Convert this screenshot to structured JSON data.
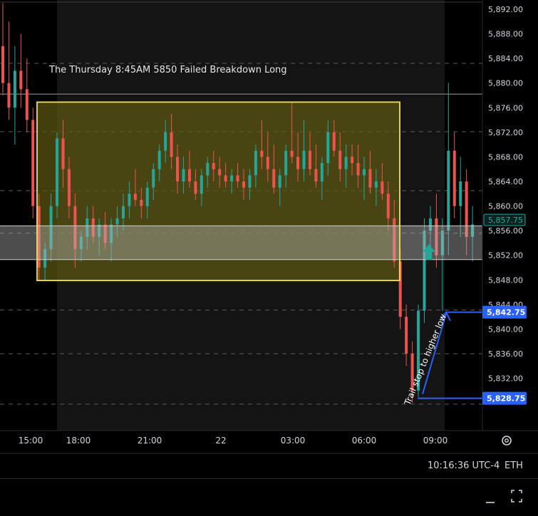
{
  "chart_data": {
    "type": "candlestick",
    "annotation_title": "The Thursday 8:45AM 5850 Failed Breakdown Long",
    "trail_label": "Trail stop to higher low",
    "ylim": [
      5823.5,
      5893.5
    ],
    "y_ticks": [
      5892,
      5888,
      5884,
      5880,
      5876,
      5872,
      5868,
      5864,
      5860,
      5856,
      5852,
      5848,
      5844,
      5840,
      5836,
      5832
    ],
    "y_tick_labels": [
      "5,892.00",
      "5,888.00",
      "5,884.00",
      "5,880.00",
      "5,876.00",
      "5,872.00",
      "5,868.00",
      "5,864.00",
      "5,860.00",
      "5,856.00",
      "5,852.00",
      "5,848.00",
      "5,844.00",
      "5,840.00",
      "5,836.00",
      "5,832.00"
    ],
    "x_tick_labels": [
      "15:00",
      "18:00",
      "21:00",
      "22",
      "03:00",
      "06:00",
      "09:00"
    ],
    "dashed_levels": [
      5883.2,
      5872.1,
      5862.5,
      5855.6,
      5843.1,
      5836.0,
      5827.8
    ],
    "resistance_level": 5878.2,
    "range_box": {
      "top": 5876.9,
      "bottom": 5847.9
    },
    "value_zone": {
      "top": 5856.8,
      "bottom": 5851.3
    },
    "price_labels": [
      {
        "text": "5,857.75",
        "value": 5857.75,
        "style": "current"
      },
      {
        "text": "5,842.75",
        "value": 5842.75,
        "style": "marker"
      },
      {
        "text": "5,828.75",
        "value": 5828.75,
        "style": "marker"
      }
    ],
    "trade_markers": [
      {
        "type": "long-arrow",
        "value": 5852.2,
        "color": "#26a69a"
      }
    ],
    "candles": [
      [
        5886,
        5893,
        5878,
        5880
      ],
      [
        5880,
        5890,
        5874,
        5876
      ],
      [
        5876,
        5886,
        5870,
        5882
      ],
      [
        5882,
        5888,
        5876,
        5879
      ],
      [
        5879,
        5884,
        5872,
        5874
      ],
      [
        5874,
        5876,
        5858,
        5860
      ],
      [
        5860,
        5862,
        5848,
        5850
      ],
      [
        5850,
        5854,
        5848,
        5853
      ],
      [
        5853,
        5862,
        5851,
        5860
      ],
      [
        5860,
        5872,
        5858,
        5871
      ],
      [
        5871,
        5874,
        5863,
        5866
      ],
      [
        5866,
        5868,
        5858,
        5860
      ],
      [
        5860,
        5862,
        5850,
        5853
      ],
      [
        5853,
        5856,
        5851,
        5855
      ],
      [
        5855,
        5860,
        5853,
        5858
      ],
      [
        5858,
        5860,
        5854,
        5855
      ],
      [
        5855,
        5858,
        5852,
        5857
      ],
      [
        5857,
        5859,
        5853,
        5854
      ],
      [
        5854,
        5858,
        5851,
        5857
      ],
      [
        5857,
        5860,
        5855,
        5858
      ],
      [
        5858,
        5862,
        5856,
        5860
      ],
      [
        5860,
        5864,
        5858,
        5862
      ],
      [
        5862,
        5866,
        5860,
        5861
      ],
      [
        5861,
        5863,
        5858,
        5860
      ],
      [
        5860,
        5864,
        5858,
        5863
      ],
      [
        5863,
        5867,
        5861,
        5866
      ],
      [
        5866,
        5870,
        5864,
        5869
      ],
      [
        5869,
        5874,
        5867,
        5872
      ],
      [
        5872,
        5875,
        5866,
        5868
      ],
      [
        5868,
        5870,
        5862,
        5864
      ],
      [
        5864,
        5868,
        5862,
        5866
      ],
      [
        5866,
        5869,
        5863,
        5864
      ],
      [
        5864,
        5866,
        5861,
        5862
      ],
      [
        5862,
        5866,
        5860,
        5865
      ],
      [
        5865,
        5868,
        5863,
        5867
      ],
      [
        5867,
        5869,
        5864,
        5866
      ],
      [
        5866,
        5868,
        5863,
        5865
      ],
      [
        5865,
        5867,
        5863,
        5864
      ],
      [
        5864,
        5866,
        5862,
        5865
      ],
      [
        5865,
        5867,
        5863,
        5864
      ],
      [
        5864,
        5866,
        5861,
        5863
      ],
      [
        5863,
        5866,
        5861,
        5865
      ],
      [
        5865,
        5870,
        5863,
        5869
      ],
      [
        5869,
        5874,
        5866,
        5868
      ],
      [
        5868,
        5872,
        5864,
        5866
      ],
      [
        5866,
        5870,
        5862,
        5863
      ],
      [
        5863,
        5866,
        5860,
        5865
      ],
      [
        5865,
        5870,
        5863,
        5869
      ],
      [
        5869,
        5877,
        5867,
        5868
      ],
      [
        5868,
        5872,
        5864,
        5866
      ],
      [
        5866,
        5874,
        5864,
        5869
      ],
      [
        5869,
        5872,
        5865,
        5866
      ],
      [
        5866,
        5870,
        5863,
        5864
      ],
      [
        5864,
        5868,
        5861,
        5867
      ],
      [
        5867,
        5874,
        5865,
        5872
      ],
      [
        5872,
        5874,
        5868,
        5869
      ],
      [
        5869,
        5872,
        5864,
        5866
      ],
      [
        5866,
        5870,
        5863,
        5868
      ],
      [
        5868,
        5870,
        5865,
        5867
      ],
      [
        5867,
        5870,
        5863,
        5865
      ],
      [
        5865,
        5868,
        5861,
        5866
      ],
      [
        5866,
        5869,
        5862,
        5863
      ],
      [
        5863,
        5866,
        5860,
        5864
      ],
      [
        5864,
        5867,
        5861,
        5862
      ],
      [
        5862,
        5864,
        5856,
        5858
      ],
      [
        5858,
        5861,
        5850,
        5851
      ],
      [
        5851,
        5853,
        5840,
        5842
      ],
      [
        5842,
        5844,
        5834,
        5836
      ],
      [
        5836,
        5838,
        5828,
        5830
      ],
      [
        5830,
        5844,
        5829,
        5843
      ],
      [
        5843,
        5858,
        5841,
        5856
      ],
      [
        5856,
        5860,
        5852,
        5858
      ],
      [
        5858,
        5862,
        5850,
        5852
      ],
      [
        5852,
        5858,
        5843,
        5856
      ],
      [
        5856,
        5880,
        5852,
        5869
      ],
      [
        5869,
        5872,
        5858,
        5860
      ],
      [
        5860,
        5868,
        5855,
        5864
      ],
      [
        5864,
        5866,
        5852,
        5855
      ],
      [
        5855,
        5860,
        5851,
        5857
      ]
    ]
  },
  "status": {
    "clock": "10:16:36 UTC-4",
    "session": "ETH"
  },
  "icons": {
    "settings": "gear-icon",
    "minimize": "minimize-icon",
    "fullscreen": "fullscreen-icon"
  }
}
